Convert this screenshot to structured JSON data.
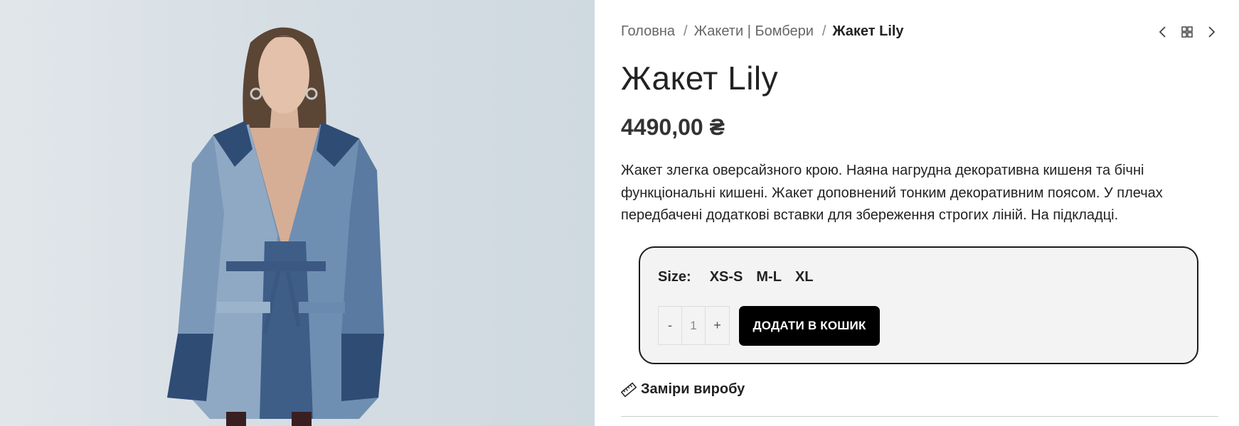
{
  "product_image": {
    "alt": "Жакет Lily"
  },
  "breadcrumb": {
    "home": "Головна",
    "separator": "/",
    "category": "Жакети | Бомбери",
    "current": "Жакет Lily"
  },
  "nav": {
    "prev_icon": "chevron-left-icon",
    "grid_icon": "grid-icon",
    "next_icon": "chevron-right-icon"
  },
  "product": {
    "title": "Жакет Lily",
    "price": "4490,00 ₴",
    "description": "Жакет злегка оверсайзного крою. Наяна нагрудна декоративна кишеня та бічні функціональні кишені. Жакет доповнений тонким декоративним поясом. У плечах передбачені додаткові вставки для збереження строгих ліній. На підкладці."
  },
  "cart": {
    "size_label": "Size",
    "size_colon": ":",
    "sizes": [
      "XS-S",
      "M-L",
      "XL"
    ],
    "qty_minus": "-",
    "qty_value": "1",
    "qty_plus": "+",
    "add_button": "ДОДАТИ В КОШИК"
  },
  "measurements": {
    "label": "Заміри виробу",
    "icon": "ruler-icon"
  },
  "colors": {
    "button_bg": "#000000",
    "box_border": "#1c1c1c",
    "box_bg": "#f3f3f3"
  }
}
